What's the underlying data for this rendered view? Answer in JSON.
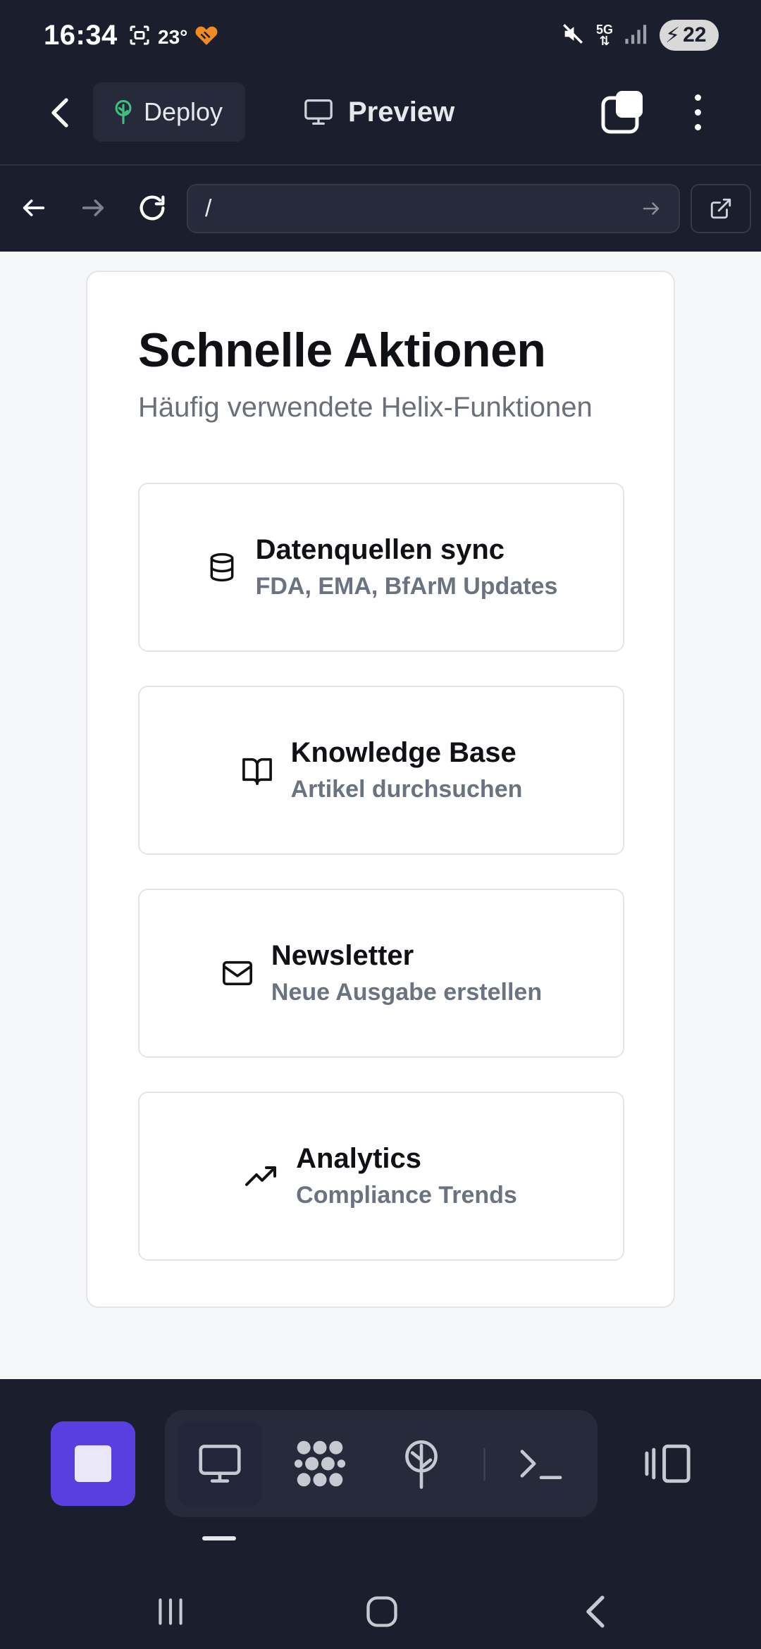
{
  "status_bar": {
    "time": "16:34",
    "temperature": "23°",
    "network": "5G",
    "battery": "22"
  },
  "app_bar": {
    "deploy_label": "Deploy",
    "preview_label": "Preview",
    "icons": [
      "chevron-left-icon",
      "tree-icon",
      "monitor-icon",
      "tabs-icon",
      "more-vertical-icon"
    ]
  },
  "nav_bar": {
    "url_value": "/",
    "icons": [
      "arrow-left-icon",
      "arrow-right-icon",
      "reload-icon",
      "arrow-right-icon",
      "external-link-icon"
    ]
  },
  "card": {
    "title": "Schnelle Aktionen",
    "subtitle": "Häufig verwendete Helix-Funktionen",
    "actions": [
      {
        "title": "Datenquellen sync",
        "description": "FDA, EMA, BfArM Updates",
        "icon": "database-icon"
      },
      {
        "title": "Knowledge Base",
        "description": "Artikel durchsuchen",
        "icon": "book-open-icon"
      },
      {
        "title": "Newsletter",
        "description": "Neue Ausgabe erstellen",
        "icon": "mail-icon"
      },
      {
        "title": "Analytics",
        "description": "Compliance Trends",
        "icon": "trending-up-icon"
      }
    ]
  },
  "bottom_bar": {
    "tools": [
      "monitor-icon",
      "integrations-icon",
      "deploy-icon",
      "terminal-icon"
    ],
    "accent": "#5a3fe0"
  },
  "colors": {
    "chrome_bg": "#1b1e2c",
    "content_bg": "#f5f6f8",
    "muted_text": "#6b7280",
    "deploy_green": "#3fbf7f"
  }
}
